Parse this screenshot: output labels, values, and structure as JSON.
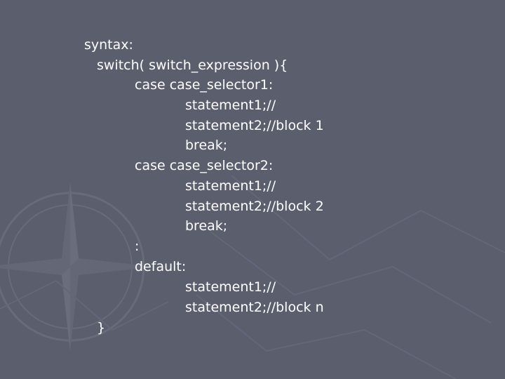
{
  "slide": {
    "background_color": "#5b5e6d",
    "text_color": "#ffffff",
    "decoration": "compass-rose-icon"
  },
  "code": {
    "lines": [
      "syntax:",
      "switch( switch_expression ){",
      "case case_selector1:",
      "statement1;//",
      "statement2;//block 1",
      "break;",
      "case case_selector2:",
      "statement1;//",
      "statement2;//block 2",
      "break;",
      ":",
      "default:",
      "statement1;//",
      "statement2;//block n",
      "}"
    ]
  }
}
